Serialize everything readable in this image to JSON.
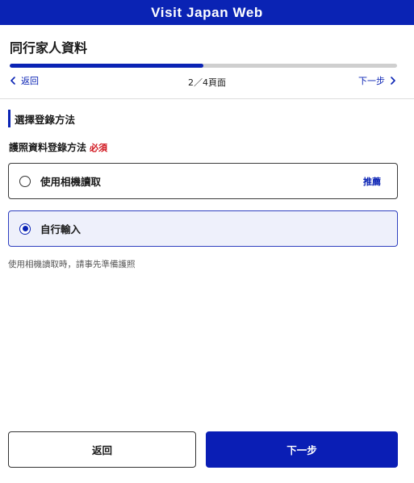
{
  "header": {
    "title": "Visit Japan Web"
  },
  "page": {
    "title": "同行家人資料"
  },
  "progress": {
    "current_step": 2,
    "total_steps": 4,
    "fraction": 0.5
  },
  "nav": {
    "prev_label": "返回",
    "page_indicator": "2／4頁面",
    "next_label": "下一步",
    "prev_icon": "chevron-left-icon",
    "next_icon": "chevron-right-icon"
  },
  "section": {
    "heading": "選擇登錄方法"
  },
  "field": {
    "label": "護照資料登錄方法",
    "required_label": "必須",
    "options": [
      {
        "label": "使用相機讀取",
        "tag": "推薦",
        "selected": false
      },
      {
        "label": "自行輸入",
        "tag": "",
        "selected": true
      }
    ],
    "hint": "使用相機讀取時，請事先準備護照"
  },
  "footer": {
    "back_label": "返回",
    "next_label": "下一步"
  },
  "colors": {
    "brand": "#0a23b4",
    "required": "#d0121b",
    "selected_bg": "#eef0fb",
    "track": "#cfcfcf"
  }
}
